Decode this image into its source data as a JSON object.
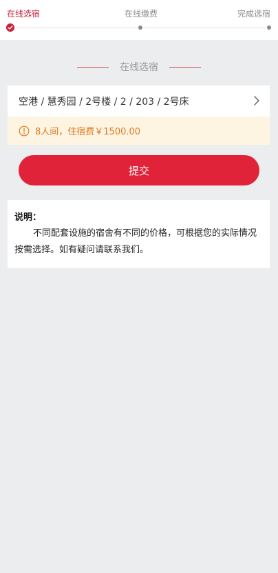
{
  "stepper": {
    "steps": [
      {
        "label": "在线选宿",
        "status": "active"
      },
      {
        "label": "在线缴费",
        "status": "pending"
      },
      {
        "label": "完成选宿",
        "status": "pending"
      }
    ]
  },
  "section": {
    "title": "在线选宿"
  },
  "selection": {
    "path": "空港 / 慧秀园 / 2号楼 / 2 / 203 / 2号床"
  },
  "notice": {
    "text": "8人间，住宿费￥1500.00",
    "icon": "info-circle-icon"
  },
  "submit": {
    "label": "提交"
  },
  "description": {
    "heading": "说明：",
    "body": "不同配套设施的宿舍有不同的价格，可根据您的实际情况按需选择。如有疑问请联系我们。"
  },
  "colors": {
    "accent": "#e12339",
    "active_step": "#c8233a",
    "notice_bg": "#fdf4e2",
    "notice_text": "#e07a1f"
  }
}
